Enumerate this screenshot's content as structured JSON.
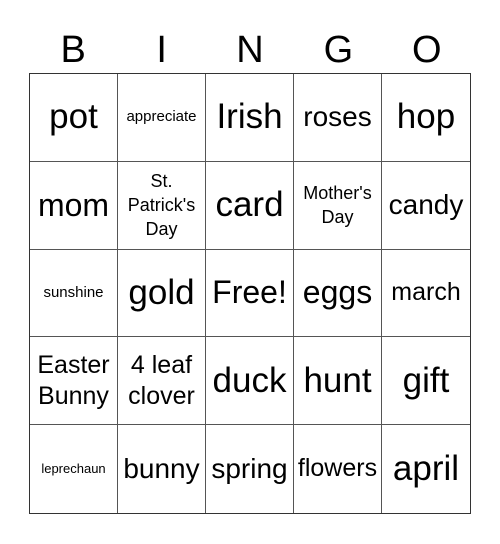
{
  "header": [
    "B",
    "I",
    "N",
    "G",
    "O"
  ],
  "cells": [
    {
      "text": "pot",
      "size": "s-xl"
    },
    {
      "text": "appreciate",
      "size": "s-xs"
    },
    {
      "text": "Irish",
      "size": "s-xl"
    },
    {
      "text": "roses",
      "size": "s-m"
    },
    {
      "text": "hop",
      "size": "s-xl"
    },
    {
      "text": "mom",
      "size": "s-l"
    },
    {
      "text": "St. Patrick's Day",
      "size": "s-s"
    },
    {
      "text": "card",
      "size": "s-xl"
    },
    {
      "text": "Mother's Day",
      "size": "s-s"
    },
    {
      "text": "candy",
      "size": "s-m"
    },
    {
      "text": "sunshine",
      "size": "s-xs"
    },
    {
      "text": "gold",
      "size": "s-xl"
    },
    {
      "text": "Free!",
      "size": "s-l"
    },
    {
      "text": "eggs",
      "size": "s-l"
    },
    {
      "text": "march",
      "size": "s-ml"
    },
    {
      "text": "Easter Bunny",
      "size": "s-ml"
    },
    {
      "text": "4 leaf clover",
      "size": "s-ml"
    },
    {
      "text": "duck",
      "size": "s-xl"
    },
    {
      "text": "hunt",
      "size": "s-xl"
    },
    {
      "text": "gift",
      "size": "s-xl"
    },
    {
      "text": "leprechaun",
      "size": "s-xxs"
    },
    {
      "text": "bunny",
      "size": "s-m"
    },
    {
      "text": "spring",
      "size": "s-m"
    },
    {
      "text": "flowers",
      "size": "s-ml"
    },
    {
      "text": "april",
      "size": "s-xl"
    }
  ]
}
